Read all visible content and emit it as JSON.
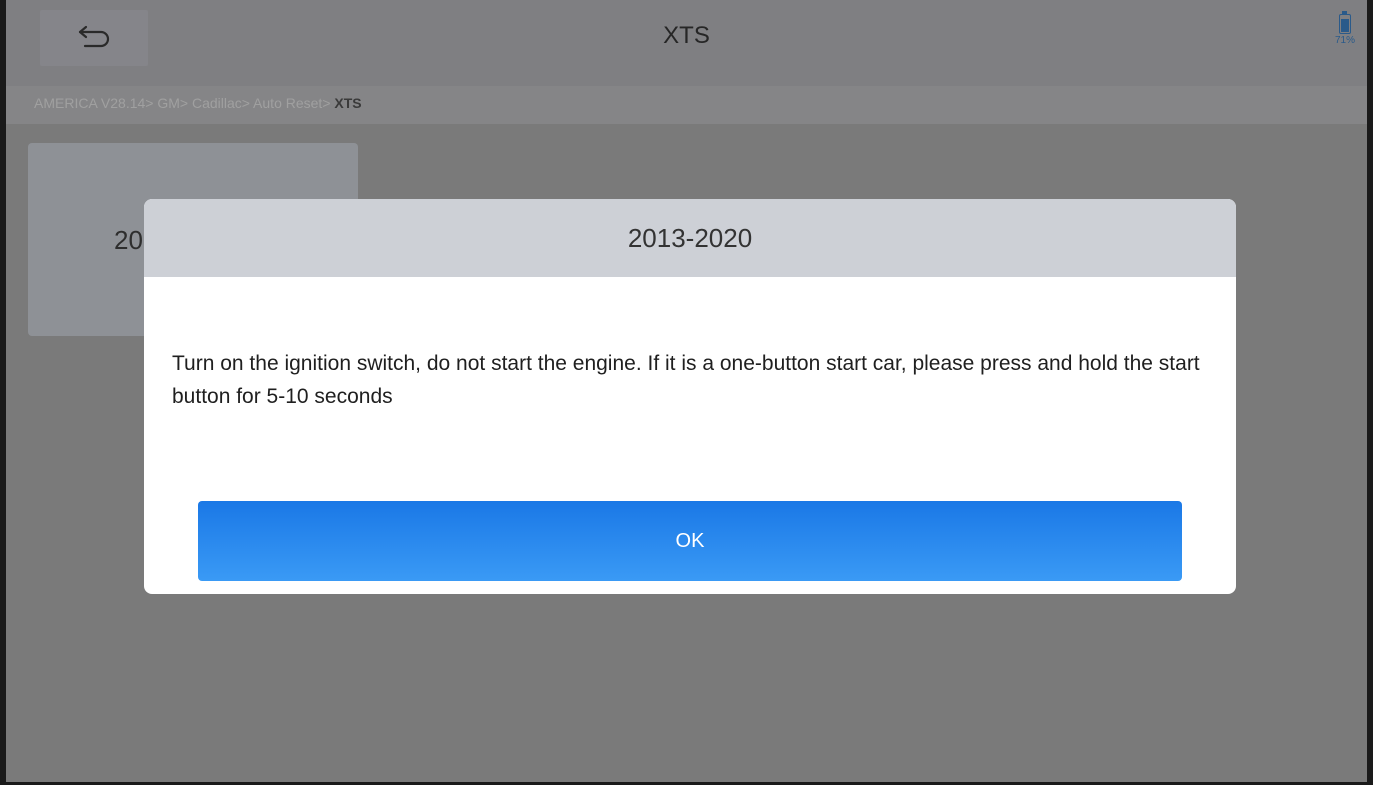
{
  "header": {
    "title": "XTS",
    "back_icon": "back-arrow-icon",
    "battery_level": "71%",
    "battery_fraction": 0.71
  },
  "breadcrumb": {
    "path": "AMERICA V28.14> GM> Cadillac> Auto Reset> ",
    "current": "XTS"
  },
  "tiles": [
    {
      "label": "2013-2020"
    }
  ],
  "dialog": {
    "title": "2013-2020",
    "message": "Turn on the ignition switch, do not start the engine. If it is a one-button start car, please press and hold the start button for 5-10 seconds",
    "ok_label": "OK"
  },
  "colors": {
    "primary_button": "#1a78e6",
    "overlay": "#7a7a7a",
    "dialog_header": "#cdd0d6"
  }
}
